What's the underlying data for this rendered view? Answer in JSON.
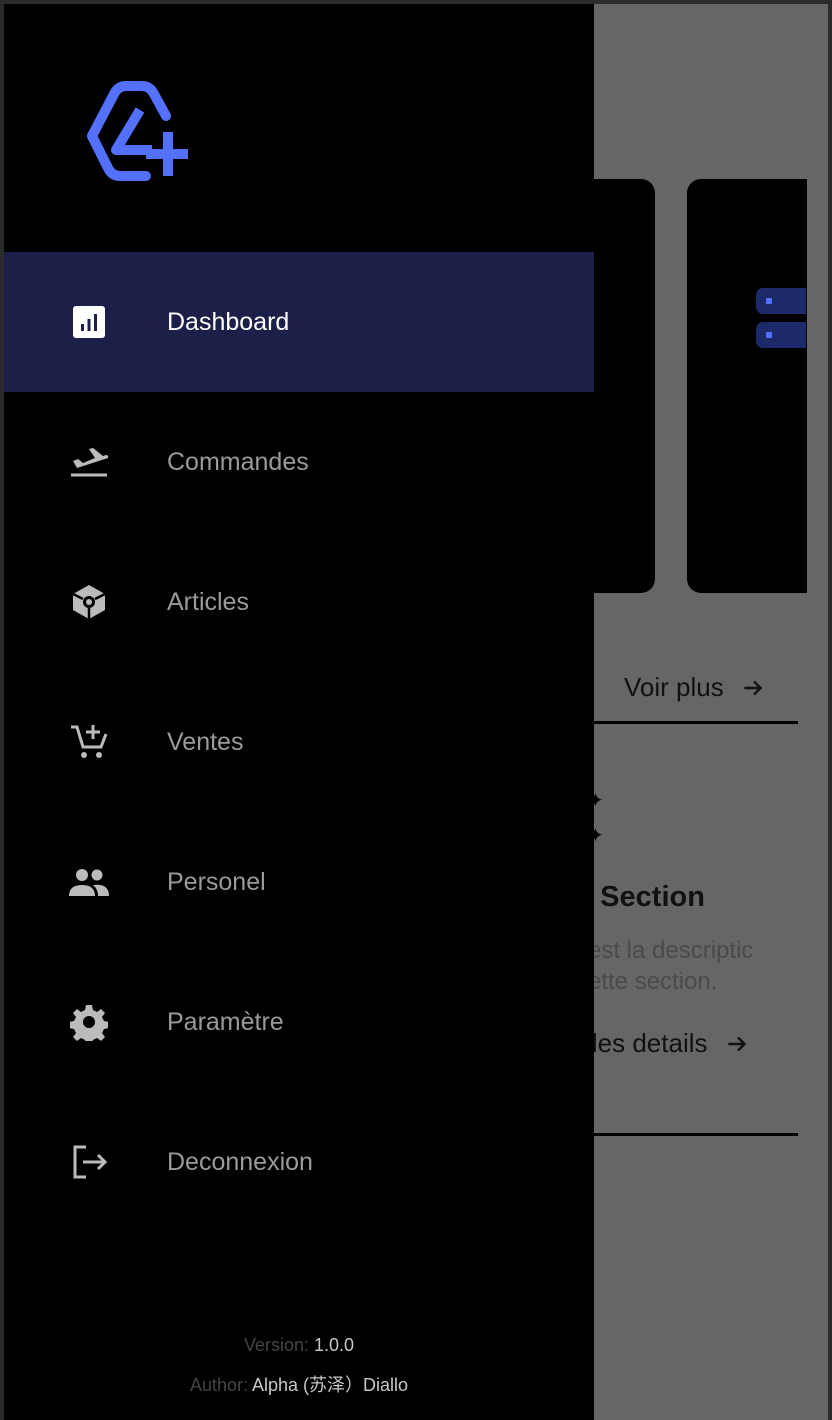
{
  "colors": {
    "accent": "#5470ff",
    "drawer_bg": "#000000",
    "active_bg": "#1c1f48",
    "inactive_text": "#9a9a9a",
    "active_text": "#ffffff",
    "overlay_bg": "#666666"
  },
  "app": {
    "logo_icon": "app-logo-icon"
  },
  "drawer": {
    "items": [
      {
        "label": "Dashboard",
        "icon": "dashboard-icon",
        "active": true
      },
      {
        "label": "Commandes",
        "icon": "flight-takeoff-icon",
        "active": false
      },
      {
        "label": "Articles",
        "icon": "package-box-icon",
        "active": false
      },
      {
        "label": "Ventes",
        "icon": "cart-add-icon",
        "active": false
      },
      {
        "label": "Personel",
        "icon": "people-icon",
        "active": false
      },
      {
        "label": "Paramètre",
        "icon": "gear-icon",
        "active": false
      },
      {
        "label": "Deconnexion",
        "icon": "logout-icon",
        "active": false
      }
    ],
    "footer": {
      "version_label": "Version:",
      "version_value": "1.0.0",
      "author_label": "Author:",
      "author_value": "Alpha (苏泽）Diallo"
    }
  },
  "background": {
    "more_link": "Voir plus",
    "section_title": "e Section",
    "section_desc_line1": "i est la descriptic",
    "section_desc_line2": "cette section.",
    "details_link": "r les details"
  }
}
